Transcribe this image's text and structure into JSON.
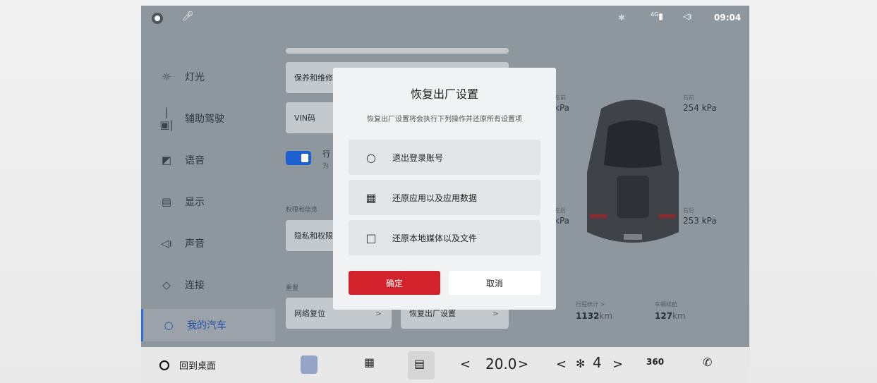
{
  "status_bar": {
    "time": "09:04",
    "icons": [
      "voice-assistant-icon",
      "mic-icon",
      "bluetooth-icon",
      "signal-icon",
      "volume-icon"
    ],
    "signal_label": "4G"
  },
  "sidebar": {
    "items": [
      {
        "label": "灯光",
        "icon": "light-icon"
      },
      {
        "label": "辅助驾驶",
        "icon": "assist-icon"
      },
      {
        "label": "语音",
        "icon": "voice-icon"
      },
      {
        "label": "显示",
        "icon": "display-icon"
      },
      {
        "label": "声音",
        "icon": "sound-icon"
      },
      {
        "label": "连接",
        "icon": "link-icon"
      },
      {
        "label": "我的汽车",
        "icon": "user-icon",
        "active": true
      }
    ]
  },
  "content": {
    "maintenance": "保养和维修",
    "vin": "VIN码",
    "toggle_label": "行",
    "toggle_sub": "为",
    "privacy_section": "权限和信息",
    "privacy": "隐私和权限",
    "reset_section": "重置",
    "network_reset": "网络复位",
    "factory_reset": "恢复出厂设置",
    "chevron": ">"
  },
  "car": {
    "tires": {
      "front_left": {
        "label": "左前",
        "value": "kPa"
      },
      "front_right": {
        "label": "右前",
        "value": "254 kPa"
      },
      "rear_left": {
        "label": "左后",
        "value": "kPa"
      },
      "rear_right": {
        "label": "右后",
        "value": "253 kPa"
      }
    },
    "trip": {
      "label": "行程统计 >",
      "value": "1132",
      "unit": "km"
    },
    "range": {
      "label": "车辆续航",
      "value": "127",
      "unit": "km"
    }
  },
  "dialog": {
    "title": "恢复出厂设置",
    "subtitle": "恢复出厂设置将会执行下列操作并还原所有设置项",
    "options": [
      {
        "label": "退出登录账号",
        "icon": "account-icon"
      },
      {
        "label": "还原应用以及应用数据",
        "icon": "apps-icon"
      },
      {
        "label": "还原本地媒体以及文件",
        "icon": "file-icon"
      }
    ],
    "confirm": "确定",
    "cancel": "取消"
  },
  "bottom_bar": {
    "home": "回到桌面",
    "temperature": "20.0",
    "temp_left": "<",
    "temp_right": ">",
    "fan_level": "4",
    "fan_left": "<",
    "fan_right": ">",
    "view_360": "360"
  },
  "colors": {
    "accent": "#2a6fd6",
    "confirm": "#d2232c"
  }
}
